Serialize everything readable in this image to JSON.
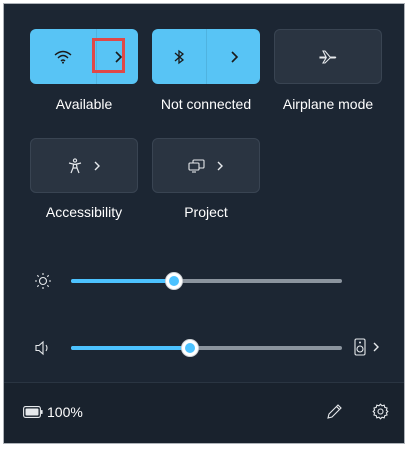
{
  "quick_settings": {
    "tiles": {
      "wifi": {
        "label": "Available",
        "state": "on",
        "icon": "wifi-icon",
        "expand_icon": "chevron-right-icon"
      },
      "bluetooth": {
        "label": "Not connected",
        "state": "on",
        "icon": "bluetooth-icon",
        "expand_icon": "chevron-right-icon"
      },
      "airplane": {
        "label": "Airplane mode",
        "state": "off",
        "icon": "airplane-icon"
      },
      "accessibility": {
        "label": "Accessibility",
        "state": "off",
        "icon": "accessibility-icon",
        "expand_icon": "chevron-right-icon"
      },
      "project": {
        "label": "Project",
        "state": "off",
        "icon": "project-icon",
        "expand_icon": "chevron-right-icon"
      }
    },
    "brightness": {
      "icon": "brightness-icon",
      "level": 0.38
    },
    "volume": {
      "icon": "speaker-icon",
      "level": 0.44,
      "output_icon": "audio-device-icon",
      "expand_icon": "chevron-right-icon"
    },
    "footer": {
      "battery_icon": "battery-icon",
      "battery_text": "100%",
      "edit_icon": "pencil-icon",
      "settings_icon": "gear-icon"
    }
  },
  "colors": {
    "panel_bg": "#1c2633",
    "tile_on": "#58c4f5",
    "tile_off": "#2a3441",
    "accent": "#4cc2ff",
    "highlight_box": "#e04848"
  }
}
